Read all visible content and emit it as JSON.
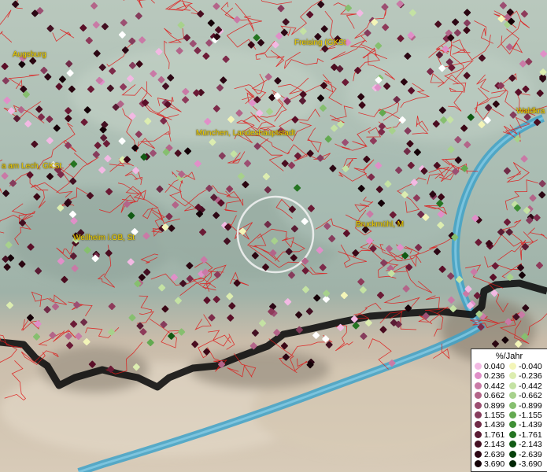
{
  "map": {
    "places": [
      {
        "id": "augsburg",
        "label": "Augsburg"
      },
      {
        "id": "freising",
        "label": "Freising (GKSt"
      },
      {
        "id": "waldkraiburg",
        "label": "Waldkra"
      },
      {
        "id": "muenchen",
        "label": "München, Landeshauptstadt"
      },
      {
        "id": "landsberg",
        "label": "a am Lech, GKSt"
      },
      {
        "id": "weilheim",
        "label": "Weilheim i.OB, St"
      },
      {
        "id": "bruckmuehl",
        "label": "Bruckmühl, M"
      }
    ]
  },
  "legend": {
    "title": "%/Jahr",
    "positive": [
      {
        "value": "0.040",
        "color": "#f2b9e3"
      },
      {
        "value": "0.236",
        "color": "#e08fc8"
      },
      {
        "value": "0.442",
        "color": "#c97aa6"
      },
      {
        "value": "0.662",
        "color": "#b36589"
      },
      {
        "value": "0.899",
        "color": "#9c4f72"
      },
      {
        "value": "1.155",
        "color": "#863c5c"
      },
      {
        "value": "1.439",
        "color": "#702b47"
      },
      {
        "value": "1.761",
        "color": "#5a1c34"
      },
      {
        "value": "2.143",
        "color": "#431022"
      },
      {
        "value": "2.639",
        "color": "#2c0714"
      },
      {
        "value": "3.690",
        "color": "#150208"
      }
    ],
    "negative": [
      {
        "value": "-0.040",
        "color": "#f3f5b8"
      },
      {
        "value": "-0.236",
        "color": "#dcedb0"
      },
      {
        "value": "-0.442",
        "color": "#c4e2a3"
      },
      {
        "value": "-0.662",
        "color": "#a7d18c"
      },
      {
        "value": "-0.899",
        "color": "#86bf6f"
      },
      {
        "value": "-1.155",
        "color": "#63a950"
      },
      {
        "value": "-1.439",
        "color": "#3f8f35"
      },
      {
        "value": "-1.761",
        "color": "#257522"
      },
      {
        "value": "-2.143",
        "color": "#115a14"
      },
      {
        "value": "-2.639",
        "color": "#06410b"
      },
      {
        "value": "-3.690",
        "color": "#012604"
      }
    ]
  }
}
